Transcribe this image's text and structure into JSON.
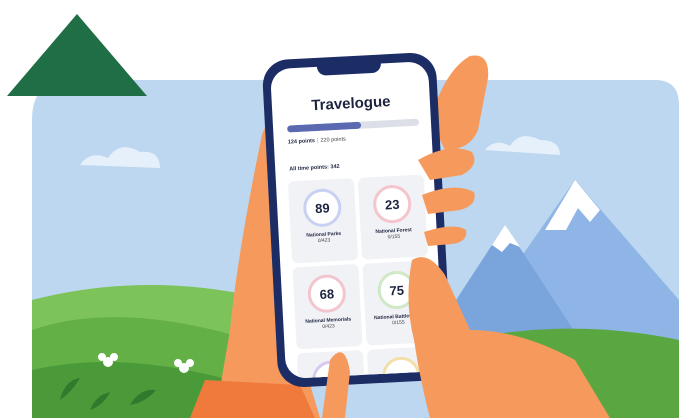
{
  "app": {
    "title": "Travelogue"
  },
  "progress": {
    "current_label": "124 points",
    "separator": "|",
    "goal_label": "220 points",
    "fraction": 0.56
  },
  "alltime": "All time points: 342",
  "cards": [
    {
      "value": "89",
      "label": "National Parks",
      "sub": "0/423",
      "ring": "#c9d1f2"
    },
    {
      "value": "23",
      "label": "National Forest",
      "sub": "0/155",
      "ring": "#f4c5cc"
    },
    {
      "value": "68",
      "label": "National Memorials",
      "sub": "0/423",
      "ring": "#f2c6cf"
    },
    {
      "value": "75",
      "label": "National Battlefields",
      "sub": "0/155",
      "ring": "#cfe9c6"
    },
    {
      "value": "",
      "label": "",
      "sub": "",
      "ring": "#d9c9f0"
    },
    {
      "value": "",
      "label": "",
      "sub": "",
      "ring": "#f3e0a8"
    }
  ],
  "colors": {
    "sky": "#b9d5ef",
    "mountain": "#7fa9e0",
    "hill_green": "#63b046",
    "skin": "#f59a5c",
    "phone_frame": "#1c2d66",
    "logo_green": "#1f6e46"
  }
}
